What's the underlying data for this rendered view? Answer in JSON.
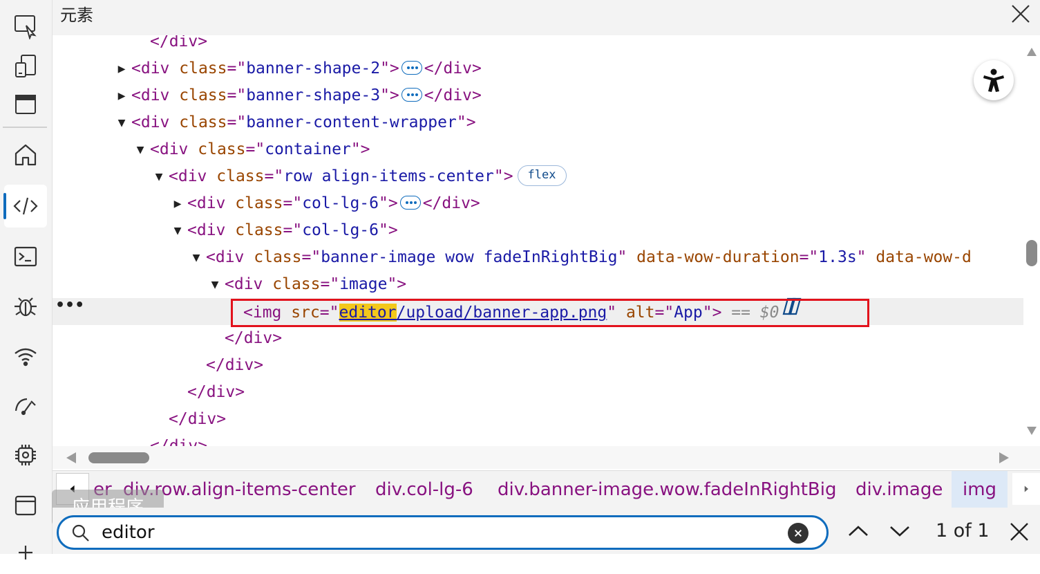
{
  "header": {
    "title": "元素"
  },
  "activity_bar": {
    "items": [
      {
        "icon": "inspect-icon"
      },
      {
        "icon": "device-emulation-icon"
      },
      {
        "icon": "dock-icon"
      },
      {
        "icon": "welcome-home-icon"
      },
      {
        "icon": "elements-icon",
        "active": true
      },
      {
        "icon": "console-icon"
      },
      {
        "icon": "sources-debugger-icon"
      },
      {
        "icon": "network-icon"
      },
      {
        "icon": "performance-icon"
      },
      {
        "icon": "memory-icon"
      },
      {
        "icon": "application-icon"
      },
      {
        "icon": "more-tools-icon"
      }
    ],
    "tooltip": "应用程序"
  },
  "dom_tree": {
    "lines": [
      {
        "indent": 4,
        "toggle": "",
        "parts": [
          [
            "tag",
            "</div>"
          ]
        ]
      },
      {
        "indent": 3,
        "toggle": "collapsed",
        "parts": [
          [
            "tag",
            "<div "
          ],
          [
            "attr-name",
            "class"
          ],
          [
            "tag",
            "=\""
          ],
          [
            "attr-value",
            "banner-shape-2"
          ],
          [
            "tag",
            "\">"
          ],
          [
            "badge",
            ""
          ],
          [
            "tag",
            "</div>"
          ]
        ]
      },
      {
        "indent": 3,
        "toggle": "collapsed",
        "parts": [
          [
            "tag",
            "<div "
          ],
          [
            "attr-name",
            "class"
          ],
          [
            "tag",
            "=\""
          ],
          [
            "attr-value",
            "banner-shape-3"
          ],
          [
            "tag",
            "\">"
          ],
          [
            "badge",
            ""
          ],
          [
            "tag",
            "</div>"
          ]
        ]
      },
      {
        "indent": 3,
        "toggle": "expanded",
        "parts": [
          [
            "tag",
            "<div "
          ],
          [
            "attr-name",
            "class"
          ],
          [
            "tag",
            "=\""
          ],
          [
            "attr-value",
            "banner-content-wrapper"
          ],
          [
            "tag",
            "\">"
          ]
        ]
      },
      {
        "indent": 4,
        "toggle": "expanded",
        "parts": [
          [
            "tag",
            "<div "
          ],
          [
            "attr-name",
            "class"
          ],
          [
            "tag",
            "=\""
          ],
          [
            "attr-value",
            "container"
          ],
          [
            "tag",
            "\">"
          ]
        ]
      },
      {
        "indent": 5,
        "toggle": "expanded",
        "parts": [
          [
            "tag",
            "<div "
          ],
          [
            "attr-name",
            "class"
          ],
          [
            "tag",
            "=\""
          ],
          [
            "attr-value",
            "row align-items-center"
          ],
          [
            "tag",
            "\">"
          ],
          [
            "flex",
            "flex"
          ]
        ]
      },
      {
        "indent": 6,
        "toggle": "collapsed",
        "parts": [
          [
            "tag",
            "<div "
          ],
          [
            "attr-name",
            "class"
          ],
          [
            "tag",
            "=\""
          ],
          [
            "attr-value",
            "col-lg-6"
          ],
          [
            "tag",
            "\">"
          ],
          [
            "badge",
            ""
          ],
          [
            "tag",
            "</div>"
          ]
        ]
      },
      {
        "indent": 6,
        "toggle": "expanded",
        "parts": [
          [
            "tag",
            "<div "
          ],
          [
            "attr-name",
            "class"
          ],
          [
            "tag",
            "=\""
          ],
          [
            "attr-value",
            "col-lg-6"
          ],
          [
            "tag",
            "\">"
          ]
        ]
      },
      {
        "indent": 7,
        "toggle": "expanded",
        "parts": [
          [
            "tag",
            "<div "
          ],
          [
            "attr-name",
            "class"
          ],
          [
            "tag",
            "=\""
          ],
          [
            "attr-value",
            "banner-image wow fadeInRightBig"
          ],
          [
            "tag",
            "\" "
          ],
          [
            "attr-name",
            "data-wow-duration"
          ],
          [
            "tag",
            "=\""
          ],
          [
            "attr-value",
            "1.3s"
          ],
          [
            "tag",
            "\" "
          ],
          [
            "attr-name",
            "data-wow-d"
          ]
        ]
      },
      {
        "indent": 8,
        "toggle": "expanded",
        "parts": [
          [
            "tag",
            "<div "
          ],
          [
            "attr-name",
            "class"
          ],
          [
            "tag",
            "=\""
          ],
          [
            "attr-value",
            "image"
          ],
          [
            "tag",
            "\">"
          ]
        ]
      },
      {
        "indent": 9,
        "toggle": "",
        "selected": true,
        "parts": [
          [
            "tag",
            "<img "
          ],
          [
            "attr-name",
            "src"
          ],
          [
            "tag",
            "=\""
          ],
          [
            "hl-link",
            "editor"
          ],
          [
            "link",
            "/upload/banner-app.png"
          ],
          [
            "tag",
            "\" "
          ],
          [
            "attr-name",
            "alt"
          ],
          [
            "tag",
            "=\""
          ],
          [
            "attr-value",
            "App"
          ],
          [
            "tag",
            "\">"
          ],
          [
            "dim",
            " == $0"
          ],
          [
            "copilot",
            ""
          ]
        ]
      },
      {
        "indent": 8,
        "toggle": "",
        "parts": [
          [
            "tag",
            "</div>"
          ]
        ]
      },
      {
        "indent": 7,
        "toggle": "",
        "parts": [
          [
            "tag",
            "</div>"
          ]
        ]
      },
      {
        "indent": 6,
        "toggle": "",
        "parts": [
          [
            "tag",
            "</div>"
          ]
        ]
      },
      {
        "indent": 5,
        "toggle": "",
        "parts": [
          [
            "tag",
            "</div>"
          ]
        ]
      },
      {
        "indent": 4,
        "toggle": "",
        "parts": [
          [
            "tag",
            "</div>"
          ]
        ]
      }
    ]
  },
  "breadcrumb": {
    "items": [
      "er",
      "div.row.align-items-center",
      "div.col-lg-6",
      "div.banner-image.wow.fadeInRightBig",
      "div.image",
      "img"
    ]
  },
  "search": {
    "value": "editor",
    "match_count": "1 of 1"
  },
  "colors": {
    "tag": "#881280",
    "attr_name": "#994500",
    "attr_value": "#1a1aa6",
    "highlight": "#f3c81b",
    "selection_outline": "#e2121c",
    "accent": "#0f6cbd"
  }
}
